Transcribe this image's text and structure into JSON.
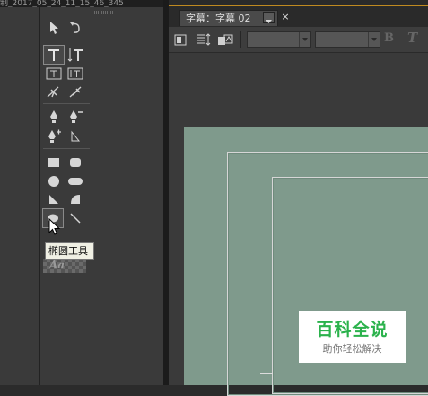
{
  "window": {
    "top_title": "制_2017_05_24_11_15_46_345"
  },
  "tools_panel": {
    "tools": [
      {
        "name": "selection-tool",
        "icon": "arrow-pointer-icon"
      },
      {
        "name": "rotation-tool",
        "icon": "rotate-icon"
      },
      {
        "name": "type-tool",
        "icon": "horizontal-type-icon",
        "selected": true
      },
      {
        "name": "vertical-type-tool",
        "icon": "vertical-type-icon"
      },
      {
        "name": "area-type-tool",
        "icon": "area-type-icon"
      },
      {
        "name": "vertical-area-type-tool",
        "icon": "vertical-area-type-icon"
      },
      {
        "name": "path-type-tool",
        "icon": "path-type-icon"
      },
      {
        "name": "vertical-path-type-tool",
        "icon": "vertical-path-type-icon"
      },
      {
        "name": "pen-tool",
        "icon": "pen-icon"
      },
      {
        "name": "delete-anchor-tool",
        "icon": "pen-minus-icon"
      },
      {
        "name": "add-anchor-tool",
        "icon": "pen-plus-icon"
      },
      {
        "name": "convert-anchor-tool",
        "icon": "convert-anchor-icon"
      },
      {
        "name": "rectangle-tool",
        "icon": "rectangle-icon"
      },
      {
        "name": "rounded-rectangle-tool",
        "icon": "rounded-rectangle-icon"
      },
      {
        "name": "clipped-corner-tool",
        "icon": "clipped-rectangle-icon"
      },
      {
        "name": "rounded-corner-tool",
        "icon": "pill-icon"
      },
      {
        "name": "wedge-tool",
        "icon": "wedge-icon"
      },
      {
        "name": "arc-tool",
        "icon": "arc-icon"
      },
      {
        "name": "ellipse-tool",
        "icon": "ellipse-icon",
        "hovered": true
      },
      {
        "name": "line-tool",
        "icon": "line-icon"
      }
    ],
    "tooltip": "椭圆工具",
    "style_preview_text": "Aa"
  },
  "title_panel": {
    "tab_label": "字幕：字幕 02",
    "close_symbol": "×",
    "toolbar": {
      "buttons": [
        {
          "name": "new-title-based-on-current",
          "icon": "new-title-icon"
        },
        {
          "name": "roll-crawl-options",
          "icon": "roll-crawl-icon"
        },
        {
          "name": "templates",
          "icon": "templates-icon"
        }
      ],
      "font_family_value": "",
      "font_style_value": "",
      "bold_label": "B",
      "italic_label": "T"
    }
  },
  "watermark": {
    "title": "百科全说",
    "subtitle": "助你轻松解决"
  },
  "colors": {
    "canvas_bg": "#7f9a8c",
    "panel_bg": "#3a3a3a",
    "watermark_green": "#2bb24c"
  }
}
